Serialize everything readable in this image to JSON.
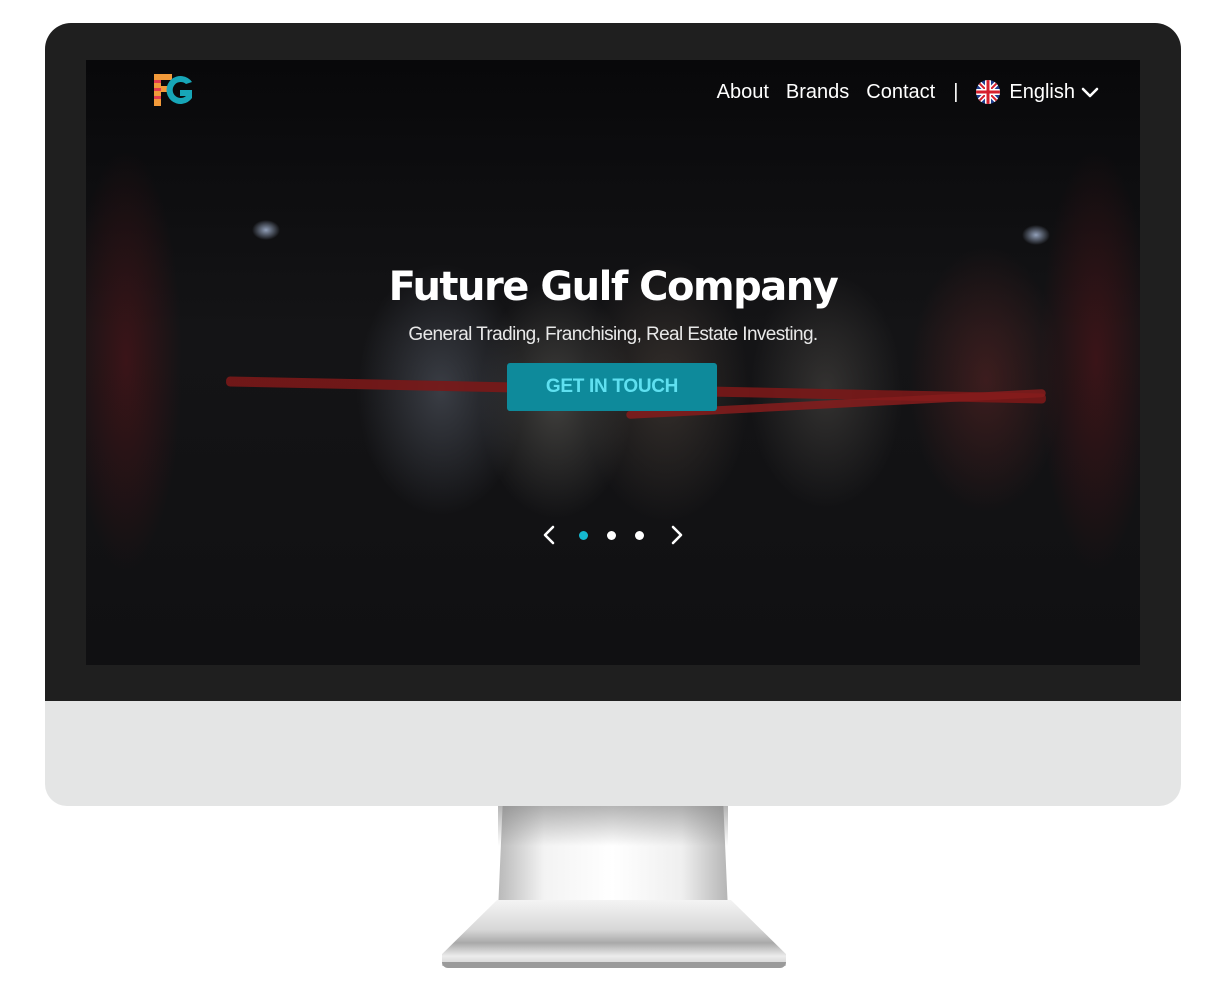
{
  "logo": {
    "text": "FG"
  },
  "nav": {
    "links": [
      "About",
      "Brands",
      "Contact"
    ],
    "separator": "|",
    "language": {
      "label": "English",
      "flag": "uk-flag-icon"
    }
  },
  "hero": {
    "title": "Future Gulf Company",
    "subtitle": "General Trading, Franchising, Real Estate Investing.",
    "cta_label": "GET IN TOUCH"
  },
  "carousel": {
    "slides": 3,
    "active_slide": 1
  },
  "colors": {
    "accent": "#0e8a9b",
    "accent_text": "#5fe0f0",
    "active_dot": "#15b8cf",
    "bezel": "#1f1f1f",
    "chin": "#e4e5e5"
  }
}
